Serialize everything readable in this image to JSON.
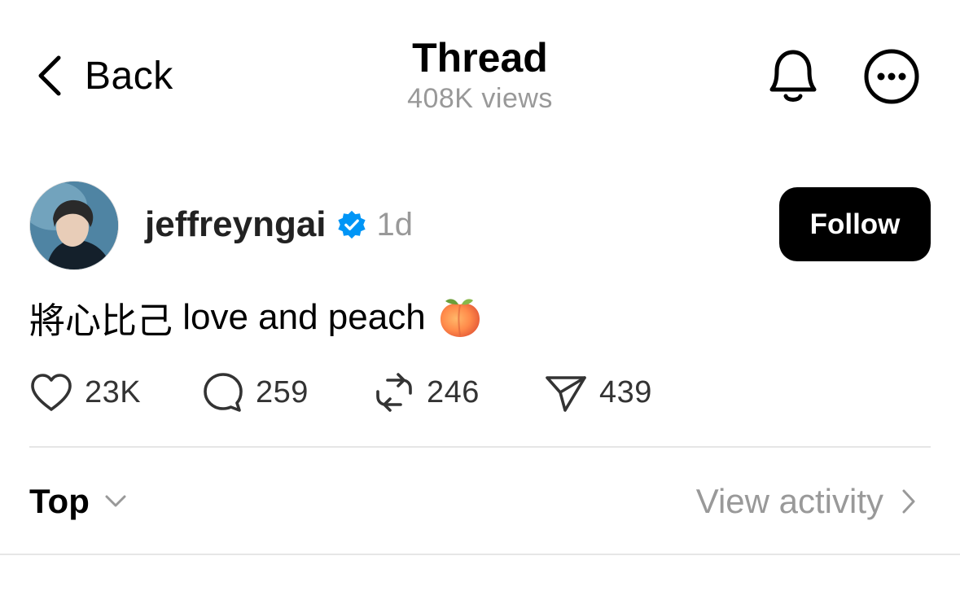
{
  "header": {
    "back_label": "Back",
    "title": "Thread",
    "views": "408K views"
  },
  "post": {
    "username": "jeffreyngai",
    "verified": true,
    "time": "1d",
    "follow_label": "Follow",
    "text_cjk": "將心比己",
    "text_latin": " love and peach",
    "emoji": "peach-emoji",
    "actions": {
      "likes": "23K",
      "replies": "259",
      "reposts": "246",
      "shares": "439"
    }
  },
  "footer": {
    "sort_label": "Top",
    "activity_label": "View activity"
  },
  "colors": {
    "secondary_text": "#999999",
    "verified_blue": "#0095F6",
    "follow_bg": "#000000",
    "divider": "#E6E6E6"
  },
  "icons": [
    "chevron-left-icon",
    "bell-icon",
    "more-icon",
    "verified-badge-icon",
    "heart-icon",
    "comment-icon",
    "repost-icon",
    "share-icon",
    "chevron-down-icon",
    "chevron-right-icon"
  ]
}
